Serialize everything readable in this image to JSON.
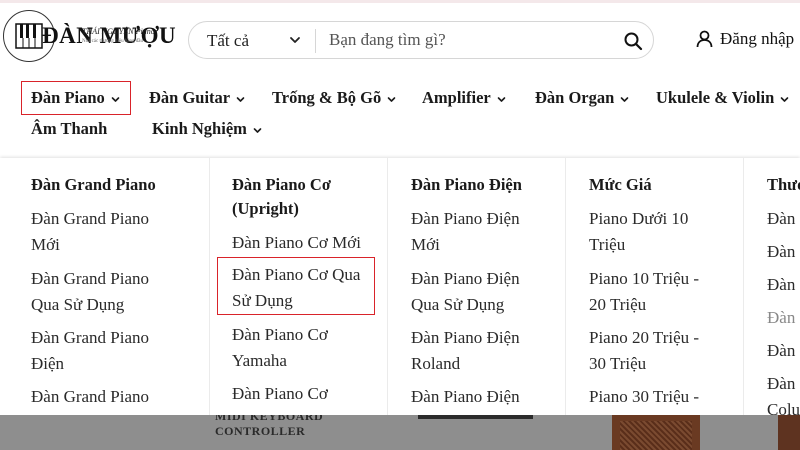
{
  "header": {
    "logo": {
      "big": "ĐÀN MƯỢU",
      "sub": "THÁI NGƯYÊN Piano",
      "sub2": "Nhà các thương hiệu hàng đầu"
    },
    "search": {
      "category": "Tất cả",
      "placeholder": "Bạn đang tìm gì?"
    },
    "login_label": "Đăng nhập"
  },
  "nav": {
    "items": [
      {
        "label": "Đàn Piano",
        "active": true
      },
      {
        "label": "Đàn Guitar"
      },
      {
        "label": "Trống & Bộ Gõ"
      },
      {
        "label": "Amplifier"
      },
      {
        "label": "Đàn Organ"
      },
      {
        "label": "Ukulele & Violin"
      },
      {
        "label": "Âm Thanh"
      },
      {
        "label": "Kinh Nghiệm"
      }
    ]
  },
  "mega": {
    "columns": [
      {
        "heading": "Đàn Grand Piano",
        "items": [
          [
            "Đàn Grand Piano",
            "Mới"
          ],
          [
            "Đàn Grand Piano",
            "Qua Sử Dụng"
          ],
          [
            "Đàn Grand Piano",
            "Điện"
          ],
          [
            "Đàn Grand Piano"
          ]
        ]
      },
      {
        "heading": [
          "Đàn Piano Cơ",
          "(Upright)"
        ],
        "items": [
          [
            "Đàn Piano Cơ Mới"
          ],
          [
            "Đàn Piano Cơ Qua",
            "Sử Dụng"
          ],
          [
            "Đàn Piano Cơ",
            "Yamaha"
          ],
          [
            "Đàn Piano Cơ"
          ]
        ]
      },
      {
        "heading": "Đàn Piano Điện",
        "items": [
          [
            "Đàn Piano Điện",
            "Mới"
          ],
          [
            "Đàn Piano Điện",
            "Qua Sử Dụng"
          ],
          [
            "Đàn Piano Điện",
            "Roland"
          ],
          [
            "Đàn Piano Điện"
          ]
        ]
      },
      {
        "heading": "Mức Giá",
        "items": [
          [
            "Piano Dưới 10",
            "Triệu"
          ],
          [
            "Piano 10 Triệu -",
            "20 Triệu"
          ],
          [
            "Piano 20 Triệu -",
            "30 Triệu"
          ],
          [
            "Piano 30 Triệu -"
          ]
        ]
      },
      {
        "heading": "Thươ",
        "items": [
          [
            "Đàn"
          ],
          [
            "Đàn"
          ],
          [
            "Đàn"
          ],
          [
            "Đàn"
          ],
          [
            "Đàn"
          ],
          [
            "Đàn",
            "Colu"
          ]
        ]
      }
    ],
    "highlighted": "Đàn Piano Cơ Qua Sử Dụng"
  },
  "bottom": {
    "text_line1": "MIDI KEYBOARD",
    "text_line2": "CONTROLLER"
  },
  "colors": {
    "highlight_border": "#d9232a",
    "text": "#1d1d1d",
    "footer_overlay": "#8e8e8e"
  }
}
